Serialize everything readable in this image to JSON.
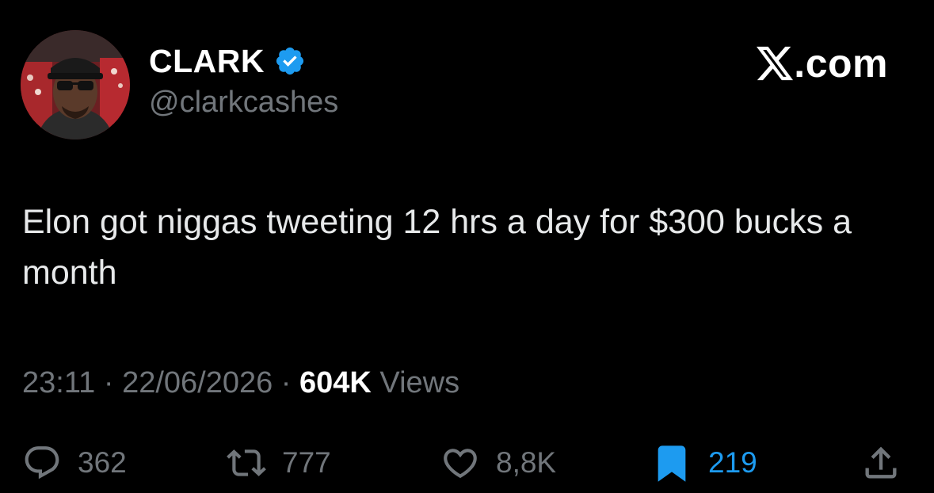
{
  "author": {
    "display_name": "CLARK",
    "handle": "@clarkcashes",
    "verified_icon": "verified-badge-icon"
  },
  "brand": {
    "icon": "x-logo-icon",
    "suffix": ".com"
  },
  "tweet": {
    "text": "Elon got niggas tweeting 12 hrs a day for $300 bucks a month"
  },
  "meta": {
    "time": "23:11",
    "separator_1": " · ",
    "date": "22/06/2026",
    "separator_2": " · ",
    "views_count": "604K",
    "views_label": " Views"
  },
  "actions": {
    "reply": {
      "icon": "reply-icon",
      "count": "362"
    },
    "retweet": {
      "icon": "retweet-icon",
      "count": "777"
    },
    "like": {
      "icon": "heart-icon",
      "count": "8,8K"
    },
    "bookmark": {
      "icon": "bookmark-icon",
      "count": "219",
      "active": true
    },
    "share": {
      "icon": "share-icon"
    }
  },
  "colors": {
    "background": "#000000",
    "text_primary": "#e7e9ea",
    "text_secondary": "#71767b",
    "accent": "#1d9bf0"
  }
}
